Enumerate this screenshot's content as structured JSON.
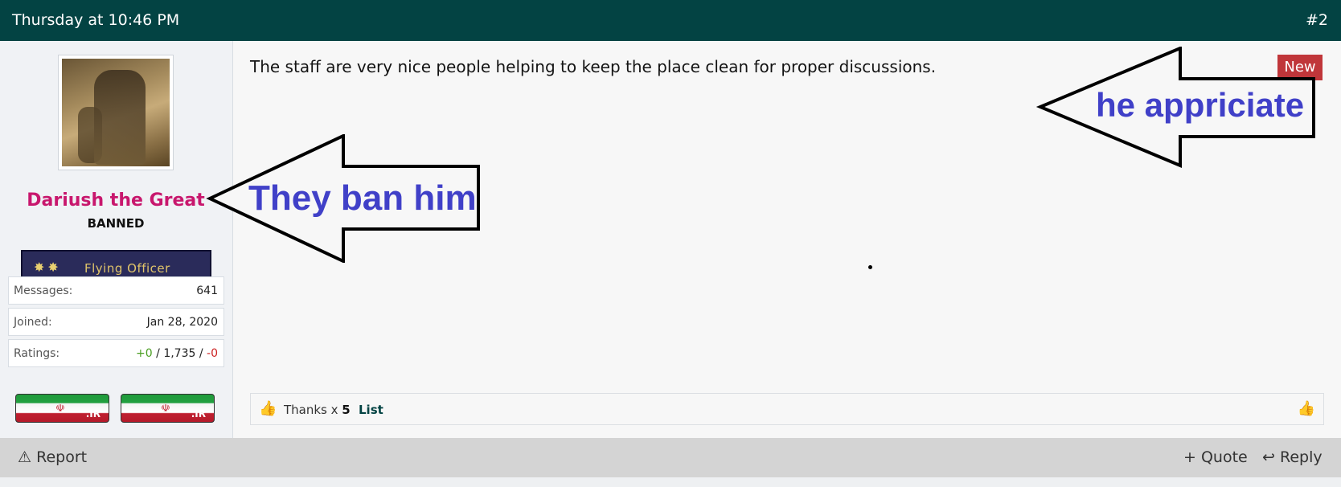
{
  "header": {
    "date": "Thursday at 10:46 PM",
    "post_number": "#2",
    "bg_color": "#034343"
  },
  "user": {
    "username": "Dariush the Great",
    "title": "BANNED",
    "rank": "Flying Officer",
    "rank_stars": "✸✸",
    "stats": [
      {
        "key": "Messages:",
        "value": "641"
      },
      {
        "key": "Joined:",
        "value": "Jan 28, 2020"
      }
    ],
    "ratings": {
      "key": "Ratings:",
      "positive": "+0",
      "sep1": " / ",
      "neutral": "1,735",
      "sep2": " / ",
      "negative": "-0"
    },
    "flags": [
      {
        "tld": ".IR"
      },
      {
        "tld": ".IR"
      }
    ]
  },
  "post": {
    "message": "The staff are very nice people helping to keep the place clean for proper discussions.",
    "new_badge": "New"
  },
  "annotations": [
    {
      "text": "he appriciate",
      "color": "#4040c8"
    },
    {
      "text": "They ban him",
      "color": "#4040c8"
    }
  ],
  "reactions": {
    "label": "Thanks x ",
    "count": "5",
    "list_label": "List"
  },
  "footer": {
    "report": "Report",
    "quote": "+ Quote",
    "reply": "Reply"
  }
}
